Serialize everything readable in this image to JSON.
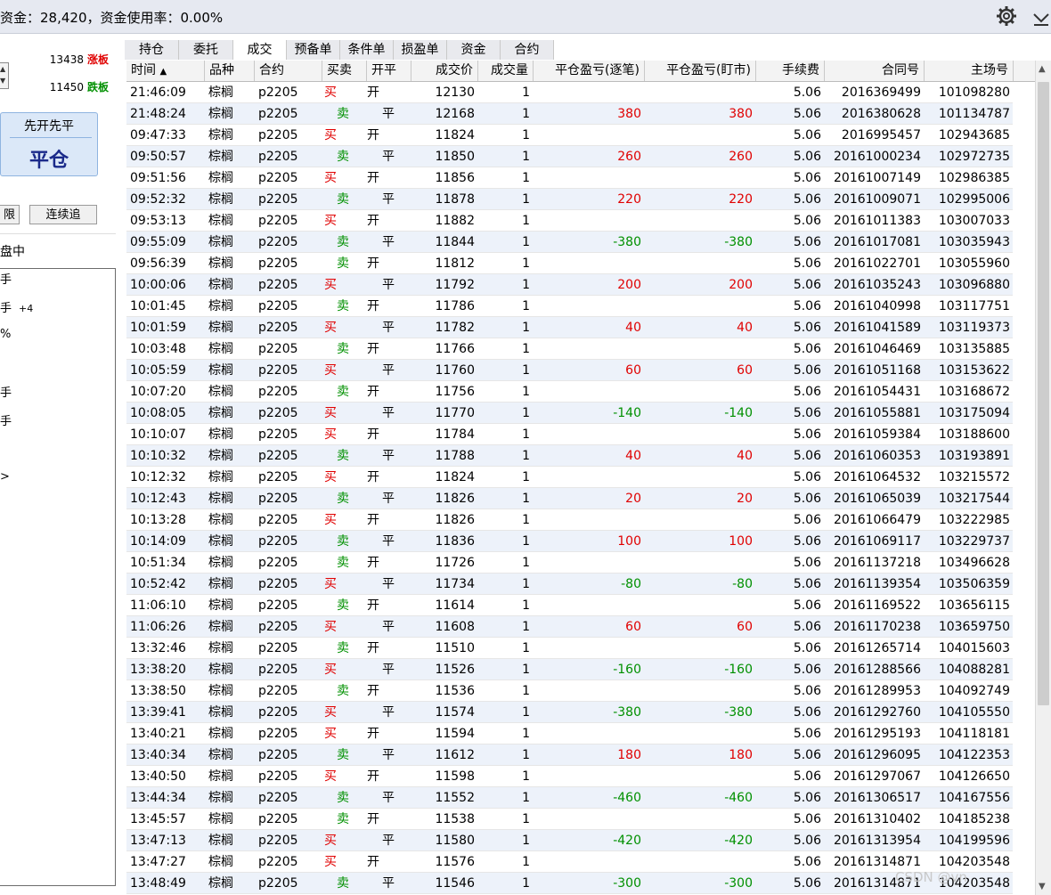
{
  "header": {
    "title": "资金：28,420，资金使用率：0.00%"
  },
  "left_panel": {
    "limit_up_value": "13438",
    "limit_up_label": "涨板",
    "limit_down_value": "11450",
    "limit_down_label": "跌板",
    "strategy": "先开先平",
    "close_label": "平仓",
    "btn_partial": "限",
    "btn_continuous": "连续追",
    "pending_label": "盘中",
    "info_lines": [
      "手",
      "手",
      "%",
      "手",
      "手",
      ">"
    ],
    "info_extra": "+4"
  },
  "tabs": [
    "持仓",
    "委托",
    "成交",
    "预备单",
    "条件单",
    "损盈单",
    "资金",
    "合约"
  ],
  "active_tab": 2,
  "columns": [
    "时间",
    "品种",
    "合约",
    "买卖",
    "开平",
    "成交价",
    "成交量",
    "平仓盈亏(逐笔)",
    "平仓盈亏(盯市)",
    "手续费",
    "合同号",
    "主场号"
  ],
  "sort_indicator": "▲",
  "rows": [
    {
      "time": "21:46:09",
      "product": "棕榈",
      "contract": "p2205",
      "side": "买",
      "oc": "开",
      "price": "12130",
      "qty": "1",
      "pnl_trade": "",
      "pnl_mark": "",
      "fee": "5.06",
      "order_no": "2016369499",
      "exch_no": "101098280"
    },
    {
      "time": "21:48:24",
      "product": "棕榈",
      "contract": "p2205",
      "side": "卖",
      "oc": "平",
      "price": "12168",
      "qty": "1",
      "pnl_trade": "380",
      "pnl_mark": "380",
      "fee": "5.06",
      "order_no": "2016380628",
      "exch_no": "101134787"
    },
    {
      "time": "09:47:33",
      "product": "棕榈",
      "contract": "p2205",
      "side": "买",
      "oc": "开",
      "price": "11824",
      "qty": "1",
      "pnl_trade": "",
      "pnl_mark": "",
      "fee": "5.06",
      "order_no": "2016995457",
      "exch_no": "102943685"
    },
    {
      "time": "09:50:57",
      "product": "棕榈",
      "contract": "p2205",
      "side": "卖",
      "oc": "平",
      "price": "11850",
      "qty": "1",
      "pnl_trade": "260",
      "pnl_mark": "260",
      "fee": "5.06",
      "order_no": "20161000234",
      "exch_no": "102972735"
    },
    {
      "time": "09:51:56",
      "product": "棕榈",
      "contract": "p2205",
      "side": "买",
      "oc": "开",
      "price": "11856",
      "qty": "1",
      "pnl_trade": "",
      "pnl_mark": "",
      "fee": "5.06",
      "order_no": "20161007149",
      "exch_no": "102986385"
    },
    {
      "time": "09:52:32",
      "product": "棕榈",
      "contract": "p2205",
      "side": "卖",
      "oc": "平",
      "price": "11878",
      "qty": "1",
      "pnl_trade": "220",
      "pnl_mark": "220",
      "fee": "5.06",
      "order_no": "20161009071",
      "exch_no": "102995006"
    },
    {
      "time": "09:53:13",
      "product": "棕榈",
      "contract": "p2205",
      "side": "买",
      "oc": "开",
      "price": "11882",
      "qty": "1",
      "pnl_trade": "",
      "pnl_mark": "",
      "fee": "5.06",
      "order_no": "20161011383",
      "exch_no": "103007033"
    },
    {
      "time": "09:55:09",
      "product": "棕榈",
      "contract": "p2205",
      "side": "卖",
      "oc": "平",
      "price": "11844",
      "qty": "1",
      "pnl_trade": "-380",
      "pnl_mark": "-380",
      "fee": "5.06",
      "order_no": "20161017081",
      "exch_no": "103035943"
    },
    {
      "time": "09:56:39",
      "product": "棕榈",
      "contract": "p2205",
      "side": "卖",
      "oc": "开",
      "price": "11812",
      "qty": "1",
      "pnl_trade": "",
      "pnl_mark": "",
      "fee": "5.06",
      "order_no": "20161022701",
      "exch_no": "103055960"
    },
    {
      "time": "10:00:06",
      "product": "棕榈",
      "contract": "p2205",
      "side": "买",
      "oc": "平",
      "price": "11792",
      "qty": "1",
      "pnl_trade": "200",
      "pnl_mark": "200",
      "fee": "5.06",
      "order_no": "20161035243",
      "exch_no": "103096880"
    },
    {
      "time": "10:01:45",
      "product": "棕榈",
      "contract": "p2205",
      "side": "卖",
      "oc": "开",
      "price": "11786",
      "qty": "1",
      "pnl_trade": "",
      "pnl_mark": "",
      "fee": "5.06",
      "order_no": "20161040998",
      "exch_no": "103117751"
    },
    {
      "time": "10:01:59",
      "product": "棕榈",
      "contract": "p2205",
      "side": "买",
      "oc": "平",
      "price": "11782",
      "qty": "1",
      "pnl_trade": "40",
      "pnl_mark": "40",
      "fee": "5.06",
      "order_no": "20161041589",
      "exch_no": "103119373"
    },
    {
      "time": "10:03:48",
      "product": "棕榈",
      "contract": "p2205",
      "side": "卖",
      "oc": "开",
      "price": "11766",
      "qty": "1",
      "pnl_trade": "",
      "pnl_mark": "",
      "fee": "5.06",
      "order_no": "20161046469",
      "exch_no": "103135885"
    },
    {
      "time": "10:05:59",
      "product": "棕榈",
      "contract": "p2205",
      "side": "买",
      "oc": "平",
      "price": "11760",
      "qty": "1",
      "pnl_trade": "60",
      "pnl_mark": "60",
      "fee": "5.06",
      "order_no": "20161051168",
      "exch_no": "103153622"
    },
    {
      "time": "10:07:20",
      "product": "棕榈",
      "contract": "p2205",
      "side": "卖",
      "oc": "开",
      "price": "11756",
      "qty": "1",
      "pnl_trade": "",
      "pnl_mark": "",
      "fee": "5.06",
      "order_no": "20161054431",
      "exch_no": "103168672"
    },
    {
      "time": "10:08:05",
      "product": "棕榈",
      "contract": "p2205",
      "side": "买",
      "oc": "平",
      "price": "11770",
      "qty": "1",
      "pnl_trade": "-140",
      "pnl_mark": "-140",
      "fee": "5.06",
      "order_no": "20161055881",
      "exch_no": "103175094"
    },
    {
      "time": "10:10:07",
      "product": "棕榈",
      "contract": "p2205",
      "side": "买",
      "oc": "开",
      "price": "11784",
      "qty": "1",
      "pnl_trade": "",
      "pnl_mark": "",
      "fee": "5.06",
      "order_no": "20161059384",
      "exch_no": "103188600"
    },
    {
      "time": "10:10:32",
      "product": "棕榈",
      "contract": "p2205",
      "side": "卖",
      "oc": "平",
      "price": "11788",
      "qty": "1",
      "pnl_trade": "40",
      "pnl_mark": "40",
      "fee": "5.06",
      "order_no": "20161060353",
      "exch_no": "103193891"
    },
    {
      "time": "10:12:32",
      "product": "棕榈",
      "contract": "p2205",
      "side": "买",
      "oc": "开",
      "price": "11824",
      "qty": "1",
      "pnl_trade": "",
      "pnl_mark": "",
      "fee": "5.06",
      "order_no": "20161064532",
      "exch_no": "103215572"
    },
    {
      "time": "10:12:43",
      "product": "棕榈",
      "contract": "p2205",
      "side": "卖",
      "oc": "平",
      "price": "11826",
      "qty": "1",
      "pnl_trade": "20",
      "pnl_mark": "20",
      "fee": "5.06",
      "order_no": "20161065039",
      "exch_no": "103217544"
    },
    {
      "time": "10:13:28",
      "product": "棕榈",
      "contract": "p2205",
      "side": "买",
      "oc": "开",
      "price": "11826",
      "qty": "1",
      "pnl_trade": "",
      "pnl_mark": "",
      "fee": "5.06",
      "order_no": "20161066479",
      "exch_no": "103222985"
    },
    {
      "time": "10:14:09",
      "product": "棕榈",
      "contract": "p2205",
      "side": "卖",
      "oc": "平",
      "price": "11836",
      "qty": "1",
      "pnl_trade": "100",
      "pnl_mark": "100",
      "fee": "5.06",
      "order_no": "20161069117",
      "exch_no": "103229737"
    },
    {
      "time": "10:51:34",
      "product": "棕榈",
      "contract": "p2205",
      "side": "卖",
      "oc": "开",
      "price": "11726",
      "qty": "1",
      "pnl_trade": "",
      "pnl_mark": "",
      "fee": "5.06",
      "order_no": "20161137218",
      "exch_no": "103496628"
    },
    {
      "time": "10:52:42",
      "product": "棕榈",
      "contract": "p2205",
      "side": "买",
      "oc": "平",
      "price": "11734",
      "qty": "1",
      "pnl_trade": "-80",
      "pnl_mark": "-80",
      "fee": "5.06",
      "order_no": "20161139354",
      "exch_no": "103506359"
    },
    {
      "time": "11:06:10",
      "product": "棕榈",
      "contract": "p2205",
      "side": "卖",
      "oc": "开",
      "price": "11614",
      "qty": "1",
      "pnl_trade": "",
      "pnl_mark": "",
      "fee": "5.06",
      "order_no": "20161169522",
      "exch_no": "103656115"
    },
    {
      "time": "11:06:26",
      "product": "棕榈",
      "contract": "p2205",
      "side": "买",
      "oc": "平",
      "price": "11608",
      "qty": "1",
      "pnl_trade": "60",
      "pnl_mark": "60",
      "fee": "5.06",
      "order_no": "20161170238",
      "exch_no": "103659750"
    },
    {
      "time": "13:32:46",
      "product": "棕榈",
      "contract": "p2205",
      "side": "卖",
      "oc": "开",
      "price": "11510",
      "qty": "1",
      "pnl_trade": "",
      "pnl_mark": "",
      "fee": "5.06",
      "order_no": "20161265714",
      "exch_no": "104015603"
    },
    {
      "time": "13:38:20",
      "product": "棕榈",
      "contract": "p2205",
      "side": "买",
      "oc": "平",
      "price": "11526",
      "qty": "1",
      "pnl_trade": "-160",
      "pnl_mark": "-160",
      "fee": "5.06",
      "order_no": "20161288566",
      "exch_no": "104088281"
    },
    {
      "time": "13:38:50",
      "product": "棕榈",
      "contract": "p2205",
      "side": "卖",
      "oc": "开",
      "price": "11536",
      "qty": "1",
      "pnl_trade": "",
      "pnl_mark": "",
      "fee": "5.06",
      "order_no": "20161289953",
      "exch_no": "104092749"
    },
    {
      "time": "13:39:41",
      "product": "棕榈",
      "contract": "p2205",
      "side": "买",
      "oc": "平",
      "price": "11574",
      "qty": "1",
      "pnl_trade": "-380",
      "pnl_mark": "-380",
      "fee": "5.06",
      "order_no": "20161292760",
      "exch_no": "104105550"
    },
    {
      "time": "13:40:21",
      "product": "棕榈",
      "contract": "p2205",
      "side": "买",
      "oc": "开",
      "price": "11594",
      "qty": "1",
      "pnl_trade": "",
      "pnl_mark": "",
      "fee": "5.06",
      "order_no": "20161295193",
      "exch_no": "104118181"
    },
    {
      "time": "13:40:34",
      "product": "棕榈",
      "contract": "p2205",
      "side": "卖",
      "oc": "平",
      "price": "11612",
      "qty": "1",
      "pnl_trade": "180",
      "pnl_mark": "180",
      "fee": "5.06",
      "order_no": "20161296095",
      "exch_no": "104122353"
    },
    {
      "time": "13:40:50",
      "product": "棕榈",
      "contract": "p2205",
      "side": "买",
      "oc": "开",
      "price": "11598",
      "qty": "1",
      "pnl_trade": "",
      "pnl_mark": "",
      "fee": "5.06",
      "order_no": "20161297067",
      "exch_no": "104126650"
    },
    {
      "time": "13:44:34",
      "product": "棕榈",
      "contract": "p2205",
      "side": "卖",
      "oc": "平",
      "price": "11552",
      "qty": "1",
      "pnl_trade": "-460",
      "pnl_mark": "-460",
      "fee": "5.06",
      "order_no": "20161306517",
      "exch_no": "104167556"
    },
    {
      "time": "13:45:57",
      "product": "棕榈",
      "contract": "p2205",
      "side": "卖",
      "oc": "开",
      "price": "11538",
      "qty": "1",
      "pnl_trade": "",
      "pnl_mark": "",
      "fee": "5.06",
      "order_no": "20161310402",
      "exch_no": "104185238"
    },
    {
      "time": "13:47:13",
      "product": "棕榈",
      "contract": "p2205",
      "side": "买",
      "oc": "平",
      "price": "11580",
      "qty": "1",
      "pnl_trade": "-420",
      "pnl_mark": "-420",
      "fee": "5.06",
      "order_no": "20161313954",
      "exch_no": "104199596"
    },
    {
      "time": "13:47:27",
      "product": "棕榈",
      "contract": "p2205",
      "side": "买",
      "oc": "开",
      "price": "11576",
      "qty": "1",
      "pnl_trade": "",
      "pnl_mark": "",
      "fee": "5.06",
      "order_no": "20161314871",
      "exch_no": "104203548"
    },
    {
      "time": "13:48:49",
      "product": "棕榈",
      "contract": "p2205",
      "side": "卖",
      "oc": "平",
      "price": "11546",
      "qty": "1",
      "pnl_trade": "-300",
      "pnl_mark": "-300",
      "fee": "5.06",
      "order_no": "20161314871",
      "exch_no": "104203548"
    }
  ],
  "watermark": "CSDN @vn",
  "colors": {
    "buy": "#e00000",
    "sell": "#009000",
    "row_alt": "#edf2fa",
    "header_bg": "#e6e9f1"
  },
  "icons": [
    "gear-icon",
    "chevron-down-icon",
    "sort-asc-icon",
    "scroll-up-icon",
    "scroll-down-icon"
  ]
}
